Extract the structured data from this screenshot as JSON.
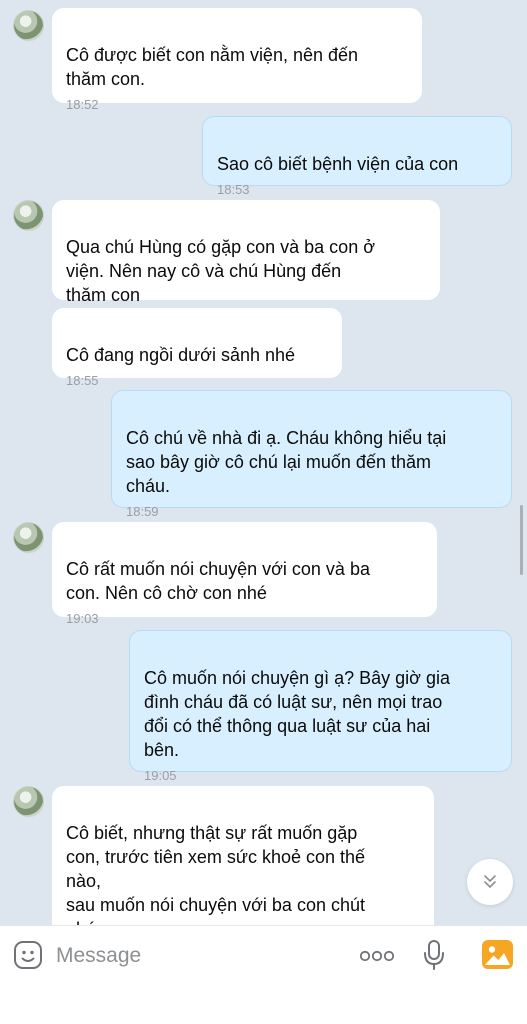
{
  "messages": [
    {
      "side": "in",
      "avatar": true,
      "text": "Cô được biết con nằm viện, nên đến\nthăm con.",
      "time": "18:52"
    },
    {
      "side": "out",
      "text": "Sao cô biết bệnh viện của con",
      "time": "18:53"
    },
    {
      "side": "in",
      "avatar": true,
      "text": "Qua chú Hùng có gặp con và ba con ở\nviện. Nên nay cô và chú Hùng đến\nthăm con",
      "time": ""
    },
    {
      "side": "in",
      "avatar": false,
      "text": "Cô đang ngồi dưới sảnh nhé",
      "time": "18:55"
    },
    {
      "side": "out",
      "text": "Cô chú về nhà đi ạ. Cháu không hiểu tại\nsao bây giờ cô chú lại muốn đến thăm\ncháu.",
      "time": "18:59"
    },
    {
      "side": "in",
      "avatar": true,
      "text": "Cô rất muốn nói chuyện với con và ba\ncon. Nên cô chờ con nhé",
      "time": "19:03"
    },
    {
      "side": "out",
      "text": "Cô muốn nói chuyện gì ạ? Bây giờ gia\nđình cháu đã có luật sư, nên mọi trao\nđổi có thể thông qua luật sư của hai\nbên.",
      "time": "19:05"
    },
    {
      "side": "in",
      "avatar": true,
      "text": "Cô biết, nhưng thật sự rất muốn gặp\ncon, trước tiên xem sức khoẻ con thế\nnào,\nsau muốn nói chuyện với ba con chút\nnhé",
      "time": ""
    }
  ],
  "composer": {
    "placeholder": "Message",
    "icons": [
      "sticker-icon",
      "more-icon",
      "microphone-icon",
      "image-icon"
    ]
  },
  "colors": {
    "background": "#dde6ee",
    "incoming_bubble": "#ffffff",
    "outgoing_bubble": "#d8efff",
    "accent": "#f5a623"
  }
}
